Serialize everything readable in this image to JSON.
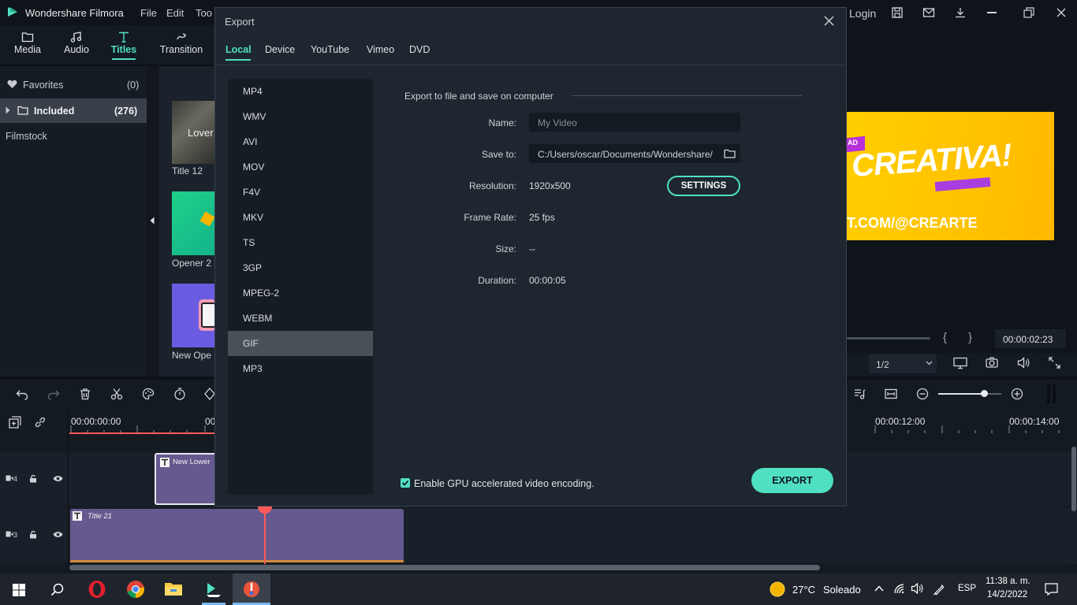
{
  "app": {
    "title": "Wondershare Filmora",
    "menu": [
      "File",
      "Edit",
      "Too"
    ],
    "login": "Login"
  },
  "nav_tabs": [
    {
      "label": "Media",
      "icon": "folder-icon"
    },
    {
      "label": "Audio",
      "icon": "music-note-icon"
    },
    {
      "label": "Titles",
      "icon": "text-t-icon",
      "active": true
    },
    {
      "label": "Transition",
      "icon": "transition-icon"
    }
  ],
  "library": {
    "favorites_label": "Favorites",
    "favorites_count": "(0)",
    "included_label": "Included",
    "included_count": "(276)",
    "filmstock_label": "Filmstock"
  },
  "thumbnails": [
    {
      "label": "Title 12",
      "text": "Lover"
    },
    {
      "label": "Opener 2"
    },
    {
      "label": "New Ope"
    }
  ],
  "preview": {
    "banner_text": "CREATIVA!",
    "banner_small": "AD",
    "banner_url": "T.COM/@CREARTE",
    "timecode": "00:00:02:23",
    "ratio": "1/2",
    "brace_open": "{",
    "brace_close": "}"
  },
  "timeline": {
    "ruler_start": "00:00:00:00",
    "ruler_cut": "00",
    "ruler_12": "00:00:12:00",
    "ruler_14": "00:00:14:00",
    "track4_label": "4",
    "track3_label": "3",
    "clip_lower": "New Lower",
    "clip_title21": "Title 21"
  },
  "dialog": {
    "title": "Export",
    "tabs": [
      "Local",
      "Device",
      "YouTube",
      "Vimeo",
      "DVD"
    ],
    "active_tab": "Local",
    "formats": [
      "MP4",
      "WMV",
      "AVI",
      "MOV",
      "F4V",
      "MKV",
      "TS",
      "3GP",
      "MPEG-2",
      "WEBM",
      "GIF",
      "MP3"
    ],
    "selected_format": "GIF",
    "section_heading": "Export to file and save on computer",
    "name_label": "Name:",
    "name_placeholder": "My Video",
    "saveto_label": "Save to:",
    "saveto_value": "C:/Users/oscar/Documents/Wondershare/",
    "resolution_label": "Resolution:",
    "resolution_value": "1920x500",
    "settings_label": "SETTINGS",
    "framerate_label": "Frame Rate:",
    "framerate_value": "25 fps",
    "size_label": "Size:",
    "size_value": "--",
    "duration_label": "Duration:",
    "duration_value": "00:00:05",
    "gpu_label": "Enable GPU accelerated video encoding.",
    "gpu_checked": true,
    "export_label": "EXPORT"
  },
  "taskbar": {
    "weather_temp": "27°C",
    "weather_desc": "Soleado",
    "lang": "ESP",
    "time": "11:38 a. m.",
    "date": "14/2/2022"
  },
  "colors": {
    "accent": "#4fe0c2",
    "clip_purple": "#66598f",
    "playhead": "#ff5a5a",
    "banner_yellow": "#ffc400"
  }
}
